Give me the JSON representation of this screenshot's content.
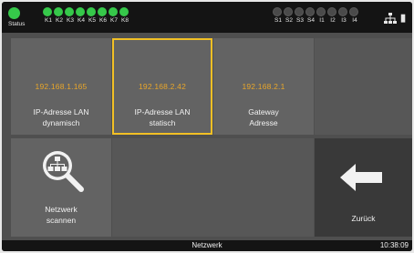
{
  "status_bar": {
    "status_label": "Status",
    "status_on": true,
    "k_labels": [
      "K1",
      "K2",
      "K3",
      "K4",
      "K5",
      "K6",
      "K7",
      "K8"
    ],
    "k_states": [
      true,
      true,
      true,
      true,
      true,
      true,
      true,
      true
    ],
    "s_labels": [
      "S1",
      "S2",
      "S3",
      "S4",
      "I1",
      "I2",
      "I3",
      "I4"
    ],
    "s_states": [
      false,
      false,
      false,
      false,
      false,
      false,
      false,
      false
    ],
    "network_icon": "network-icon"
  },
  "tiles": {
    "lan_dynamic": {
      "ip": "192.168.1.165",
      "line1": "IP-Adresse LAN",
      "line2": "dynamisch"
    },
    "lan_static": {
      "ip": "192.168.2.42",
      "line1": "IP-Adresse LAN",
      "line2": "statisch"
    },
    "gateway": {
      "ip": "192.168.2.1",
      "line1": "Gateway",
      "line2": "Adresse"
    },
    "scan": {
      "line1": "Netzwerk",
      "line2": "scannen",
      "icon": "network-search-icon"
    },
    "back": {
      "label": "Zurück",
      "icon": "arrow-left-icon"
    }
  },
  "footer": {
    "title": "Netzwerk",
    "clock": "10:38:09"
  },
  "colors": {
    "led_on": "#36c84a",
    "ip_text": "#e8a62a",
    "selection": "#f2c025",
    "tile": "#636363"
  }
}
